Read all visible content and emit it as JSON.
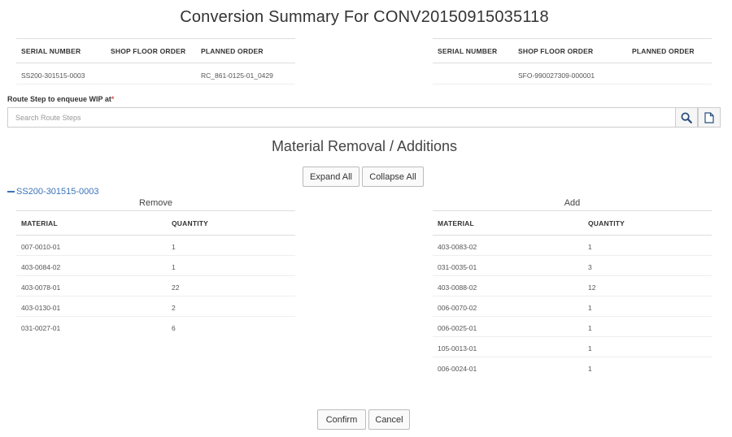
{
  "page_title": "Conversion Summary For CONV20150915035118",
  "summary_left": {
    "headers": [
      "SERIAL NUMBER",
      "SHOP FLOOR ORDER",
      "PLANNED ORDER"
    ],
    "row": [
      "SS200-301515-0003",
      "",
      "RC_861-0125-01_0429"
    ]
  },
  "summary_right": {
    "headers": [
      "SERIAL NUMBER",
      "SHOP FLOOR ORDER",
      "PLANNED ORDER"
    ],
    "row": [
      "",
      "SFO-990027309-000001",
      ""
    ]
  },
  "route": {
    "label": "Route Step to enqueue WIP at",
    "required_mark": "*",
    "placeholder": "Search Route Steps"
  },
  "icons": {
    "search": "search-icon",
    "document": "document-icon"
  },
  "section_title": "Material Removal / Additions",
  "buttons": {
    "expand_all": "Expand All",
    "collapse_all": "Collapse All",
    "confirm": "Confirm",
    "cancel": "Cancel"
  },
  "tree_node": "SS200-301515-0003",
  "remove": {
    "title": "Remove",
    "headers": [
      "MATERIAL",
      "QUANTITY"
    ],
    "rows": [
      [
        "007-0010-01",
        "1"
      ],
      [
        "403-0084-02",
        "1"
      ],
      [
        "403-0078-01",
        "22"
      ],
      [
        "403-0130-01",
        "2"
      ],
      [
        "031-0027-01",
        "6"
      ]
    ]
  },
  "add": {
    "title": "Add",
    "headers": [
      "MATERIAL",
      "QUANTITY"
    ],
    "rows": [
      [
        "403-0083-02",
        "1"
      ],
      [
        "031-0035-01",
        "3"
      ],
      [
        "403-0088-02",
        "12"
      ],
      [
        "006-0070-02",
        "1"
      ],
      [
        "006-0025-01",
        "1"
      ],
      [
        "105-0013-01",
        "1"
      ],
      [
        "006-0024-01",
        "1"
      ]
    ]
  },
  "colors": {
    "link": "#3a73b8",
    "required": "#d9534f",
    "border": "#dddddd"
  }
}
